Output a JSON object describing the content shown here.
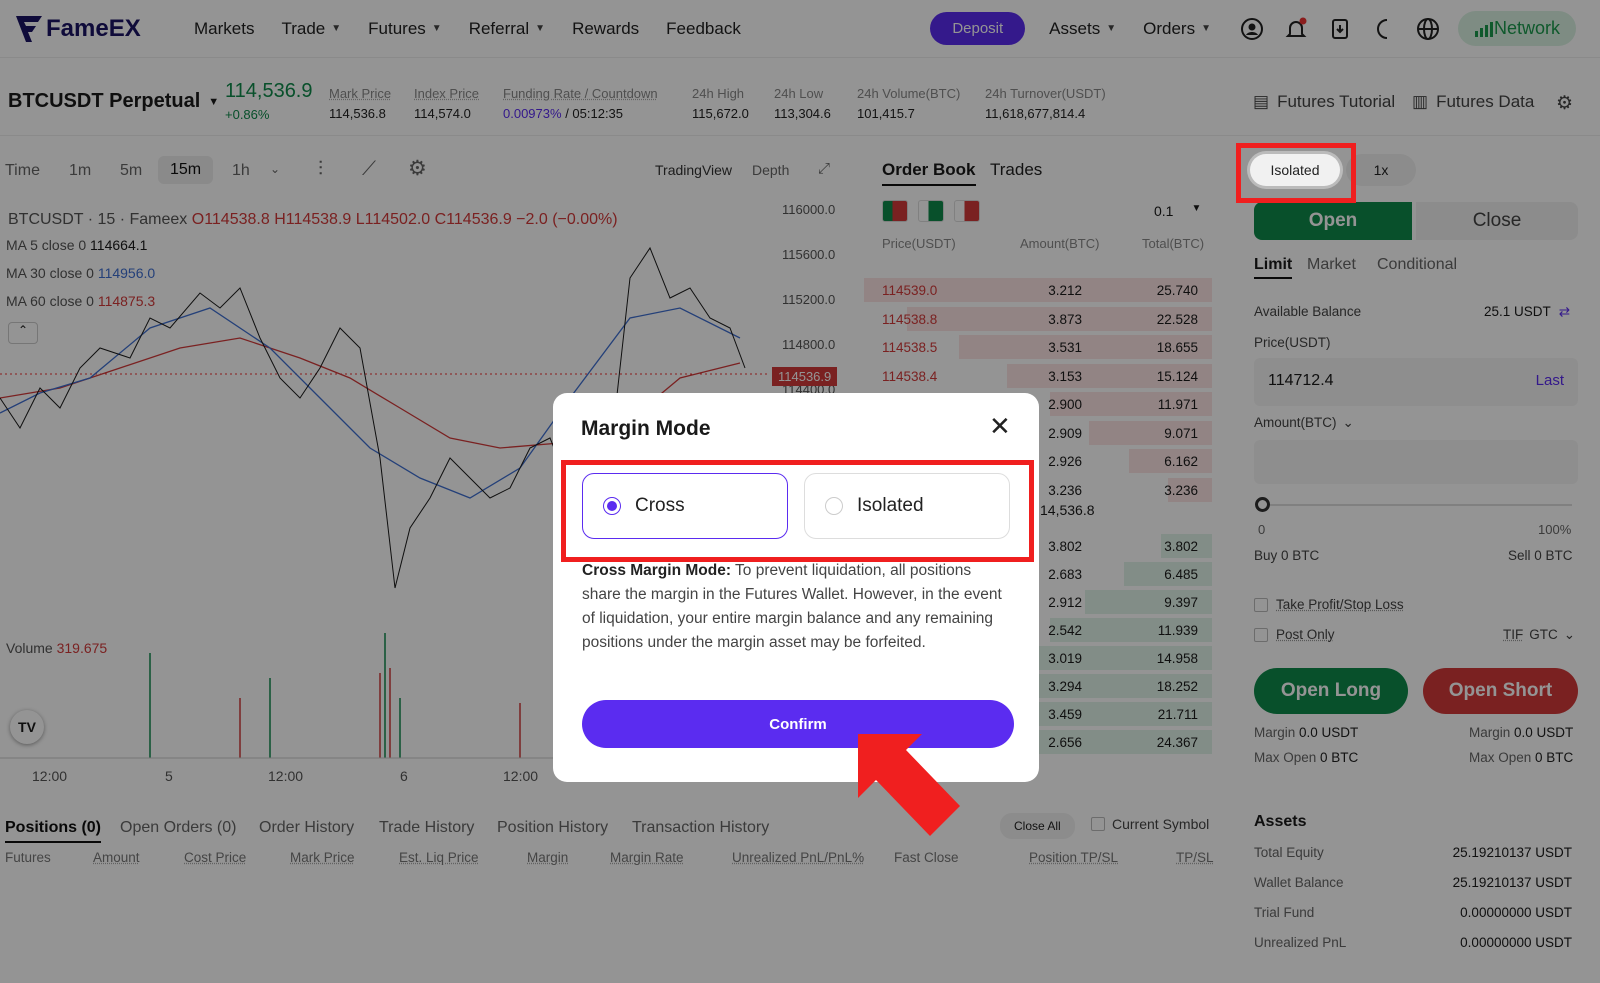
{
  "nav": {
    "brand": "FameEX",
    "items": [
      "Markets",
      "Trade",
      "Futures",
      "Referral",
      "Rewards",
      "Feedback"
    ],
    "deposit": "Deposit",
    "assets": "Assets",
    "orders": "Orders",
    "network": "Network"
  },
  "ticker": {
    "symbol": "BTCUSDT Perpetual",
    "last": "114,536.9",
    "change": "+0.86%",
    "mark_label": "Mark Price",
    "mark": "114,536.8",
    "index_label": "Index Price",
    "index": "114,574.0",
    "funding_label": "Funding Rate / Countdown",
    "funding": "0.00973%",
    "countdown": "/ 05:12:35",
    "high_label": "24h High",
    "high": "115,672.0",
    "low_label": "24h Low",
    "low": "113,304.6",
    "vol_label": "24h Volume(BTC)",
    "vol": "101,415.7",
    "turn_label": "24h Turnover(USDT)",
    "turn": "11,618,677,814.4",
    "tutorial": "Futures Tutorial",
    "data": "Futures Data"
  },
  "chart": {
    "time": "Time",
    "intervals": [
      "1m",
      "5m",
      "15m",
      "1h"
    ],
    "tradingview": "TradingView",
    "depth": "Depth",
    "legend": "BTCUSDT · 15 · Fameex",
    "ohlc": "O114538.8 H114538.9 L114502.0 C114536.9 −2.0 (−0.00%)",
    "ma5": "MA 5 close 0",
    "ma5v": "114664.1",
    "ma30": "MA 30 close 0",
    "ma30v": "114956.0",
    "ma60": "MA 60 close 0",
    "ma60v": "114875.3",
    "volume": "Volume",
    "volume_v": "319.675",
    "price_ticks": [
      "116000.0",
      "115600.0",
      "115200.0",
      "114800.0",
      "114400.0"
    ],
    "last_price_tag": "114536.9",
    "time_ticks": [
      "12:00",
      "5",
      "12:00",
      "6",
      "12:00"
    ]
  },
  "orderbook": {
    "tab1": "Order Book",
    "tab2": "Trades",
    "precision": "0.1",
    "h_price": "Price(USDT)",
    "h_amount": "Amount(BTC)",
    "h_total": "Total(BTC)",
    "asks": [
      [
        "114539.0",
        "3.212",
        "25.740"
      ],
      [
        "114538.8",
        "3.873",
        "22.528"
      ],
      [
        "114538.5",
        "3.531",
        "18.655"
      ],
      [
        "114538.4",
        "3.153",
        "15.124"
      ],
      [
        "",
        "2.900",
        "11.971"
      ],
      [
        "",
        "2.909",
        "9.071"
      ],
      [
        "",
        "2.926",
        "6.162"
      ],
      [
        "",
        "3.236",
        "3.236"
      ]
    ],
    "mid": "14,536.8",
    "bids": [
      [
        "",
        "3.802",
        "3.802"
      ],
      [
        "",
        "2.683",
        "6.485"
      ],
      [
        "",
        "2.912",
        "9.397"
      ],
      [
        "",
        "2.542",
        "11.939"
      ],
      [
        "",
        "3.019",
        "14.958"
      ],
      [
        "",
        "3.294",
        "18.252"
      ],
      [
        "",
        "3.459",
        "21.711"
      ],
      [
        "",
        "2.656",
        "24.367"
      ]
    ]
  },
  "trade": {
    "mode": "Isolated",
    "leverage": "1x",
    "open": "Open",
    "close": "Close",
    "limit": "Limit",
    "market": "Market",
    "conditional": "Conditional",
    "avail_label": "Available Balance",
    "avail": "25.1 USDT",
    "price_label": "Price(USDT)",
    "price": "114712.4",
    "last": "Last",
    "amount_label": "Amount(BTC)",
    "slider_min": "0",
    "slider_max": "100%",
    "buy": "Buy 0 BTC",
    "sell": "Sell 0 BTC",
    "tpsl": "Take Profit/Stop Loss",
    "post_only": "Post Only",
    "tif_label": "TIF",
    "tif": "GTC",
    "open_long": "Open Long",
    "open_short": "Open Short",
    "margin_l": "Margin",
    "margin_lv": "0.0 USDT",
    "maxopen_l": "Max Open",
    "maxopen_lv": "0 BTC"
  },
  "bottom": {
    "tabs": [
      "Positions (0)",
      "Open Orders (0)",
      "Order History",
      "Trade History",
      "Position History",
      "Transaction History"
    ],
    "close_all": "Close All",
    "current_symbol": "Current Symbol",
    "cols": [
      "Futures",
      "Amount",
      "Cost Price",
      "Mark Price",
      "Est. Liq Price",
      "Margin",
      "Margin Rate",
      "Unrealized PnL/PnL%",
      "Fast Close",
      "Position TP/SL",
      "TP/SL"
    ]
  },
  "assets": {
    "title": "Assets",
    "rows": [
      [
        "Total Equity",
        "25.19210137 USDT"
      ],
      [
        "Wallet Balance",
        "25.19210137 USDT"
      ],
      [
        "Trial Fund",
        "0.00000000 USDT"
      ],
      [
        "Unrealized PnL",
        "0.00000000 USDT"
      ]
    ]
  },
  "modal": {
    "title": "Margin Mode",
    "cross": "Cross",
    "isolated": "Isolated",
    "desc_bold": "Cross Margin Mode:",
    "desc": "To prevent liquidation, all positions share the margin in the Futures Wallet. However, in the event of liquidation, your entire margin balance and any remaining positions under the margin asset may be forfeited.",
    "confirm": "Confirm"
  },
  "colors": {
    "accent": "#5b2cf0",
    "green": "#0f8a4a",
    "red": "#d33a3a",
    "highlight": "#f01f1f"
  }
}
